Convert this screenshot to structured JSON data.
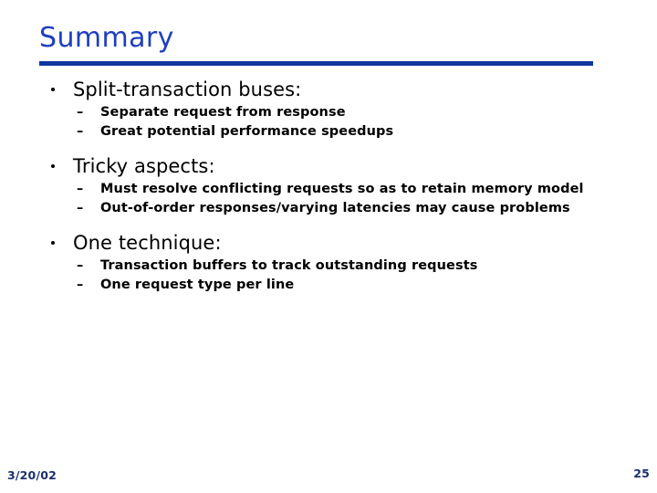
{
  "slide": {
    "title": "Summary",
    "title_color": "#1f3fbd",
    "rule_color": "#0f37a0",
    "background_color": "#ffffff",
    "body_text_color": "#000000",
    "footer_color": "#1b2f6e",
    "bullet_glyph": "•",
    "subbullet_glyph": "–",
    "groups": [
      {
        "heading": "Split-transaction buses:",
        "items": [
          "Separate request from response",
          "Great potential performance speedups"
        ]
      },
      {
        "heading": "Tricky aspects:",
        "items": [
          "Must resolve conflicting requests so as to retain memory model",
          "Out-of-order responses/varying latencies may cause problems"
        ]
      },
      {
        "heading": "One technique:",
        "items": [
          "Transaction buffers to track outstanding requests",
          "One request type per line"
        ]
      }
    ],
    "footer": {
      "date": "3/20/02",
      "page_number": "25"
    }
  }
}
